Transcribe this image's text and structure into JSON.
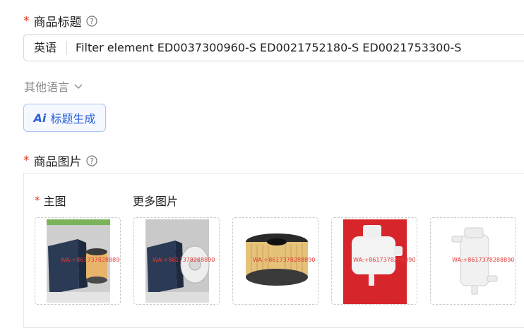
{
  "title_section": {
    "label": "商品标题",
    "lang_label": "英语",
    "title_value": "Filter element ED0037300960-S ED0021752180-S ED0021753300-S"
  },
  "other_lang": {
    "label": "其他语言"
  },
  "generate": {
    "ai_mark": "Ai",
    "label": "标题生成"
  },
  "images_section": {
    "label": "商品图片",
    "main_label": "主图",
    "more_label": "更多图片",
    "watermark": "WA:+8617378288890",
    "images": [
      {
        "name": "product-photo-1"
      },
      {
        "name": "product-photo-2"
      },
      {
        "name": "product-photo-3"
      },
      {
        "name": "product-photo-4"
      },
      {
        "name": "product-photo-5"
      }
    ]
  },
  "colors": {
    "required": "#e0341c",
    "accent": "#2b5fd9"
  },
  "icons": [
    "help-icon",
    "chevron-down-icon",
    "ai-icon"
  ]
}
